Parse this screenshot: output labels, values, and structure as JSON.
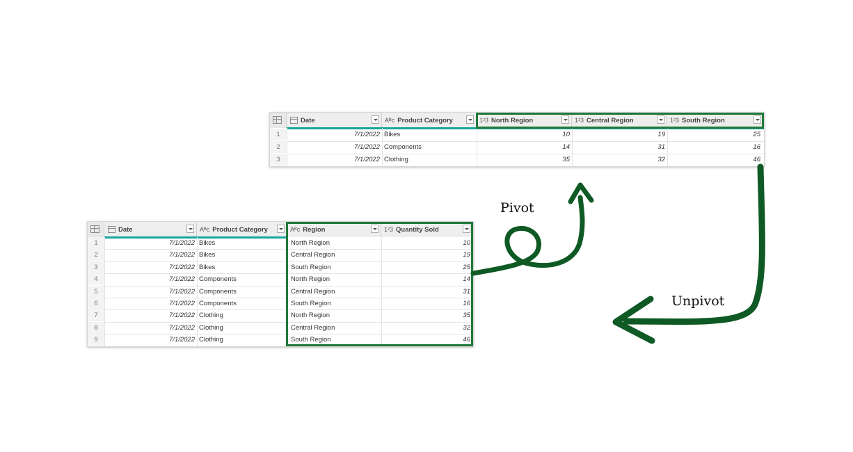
{
  "top_table": {
    "columns": [
      {
        "type": "",
        "label": "Date"
      },
      {
        "type": "Aᴮᴄ",
        "label": "Product Category"
      },
      {
        "type": "1²3",
        "label": "North Region"
      },
      {
        "type": "1²3",
        "label": "Central Region"
      },
      {
        "type": "1²3",
        "label": "South Region"
      }
    ],
    "rows": [
      [
        "1",
        "7/1/2022",
        "Bikes",
        "10",
        "19",
        "25"
      ],
      [
        "2",
        "7/1/2022",
        "Components",
        "14",
        "31",
        "16"
      ],
      [
        "3",
        "7/1/2022",
        "Clothing",
        "35",
        "32",
        "46"
      ]
    ]
  },
  "bottom_table": {
    "columns": [
      {
        "type": "",
        "label": "Date"
      },
      {
        "type": "Aᴮᴄ",
        "label": "Product Category"
      },
      {
        "type": "Aᴮᴄ",
        "label": "Region"
      },
      {
        "type": "1²3",
        "label": "Quantity Sold"
      }
    ],
    "rows": [
      [
        "1",
        "7/1/2022",
        "Bikes",
        "North Region",
        "10"
      ],
      [
        "2",
        "7/1/2022",
        "Bikes",
        "Central Region",
        "19"
      ],
      [
        "3",
        "7/1/2022",
        "Bikes",
        "South Region",
        "25"
      ],
      [
        "4",
        "7/1/2022",
        "Components",
        "North Region",
        "14"
      ],
      [
        "5",
        "7/1/2022",
        "Components",
        "Central Region",
        "31"
      ],
      [
        "6",
        "7/1/2022",
        "Components",
        "South Region",
        "16"
      ],
      [
        "7",
        "7/1/2022",
        "Clothing",
        "North Region",
        "35"
      ],
      [
        "8",
        "7/1/2022",
        "Clothing",
        "Central Region",
        "32"
      ],
      [
        "9",
        "7/1/2022",
        "Clothing",
        "South Region",
        "46"
      ]
    ]
  },
  "labels": {
    "pivot": "Pivot",
    "unpivot": "Unpivot"
  },
  "colors": {
    "arrow": "#0f5a24",
    "highlight": "#1e7a3a",
    "teal": "#1aa59a"
  }
}
